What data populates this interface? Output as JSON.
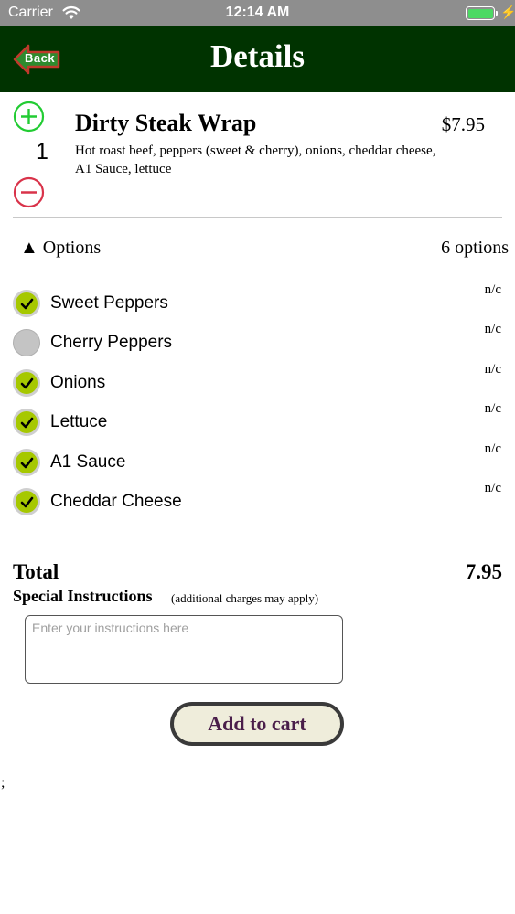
{
  "status_bar": {
    "carrier": "Carrier",
    "time": "12:14 AM",
    "battery_color": "#4cd964"
  },
  "nav": {
    "back_label": "Back",
    "title": "Details",
    "background_color": "#003300"
  },
  "item": {
    "quantity": "1",
    "name": "Dirty Steak Wrap",
    "price": "$7.95",
    "description": "Hot roast beef, peppers (sweet & cherry), onions, cheddar cheese, A1 Sauce, lettuce"
  },
  "options": {
    "toggle_label": "▲ Options",
    "count_label": "6 options",
    "items": [
      {
        "label": "Sweet Peppers",
        "price": "n/c",
        "checked": true
      },
      {
        "label": "Cherry Peppers",
        "price": "n/c",
        "checked": false
      },
      {
        "label": "Onions",
        "price": "n/c",
        "checked": true
      },
      {
        "label": "Lettuce",
        "price": "n/c",
        "checked": true
      },
      {
        "label": "A1 Sauce",
        "price": "n/c",
        "checked": true
      },
      {
        "label": "Cheddar Cheese",
        "price": "n/c",
        "checked": true
      }
    ]
  },
  "total": {
    "label": "Total",
    "value": "7.95"
  },
  "special_instructions": {
    "title": "Special Instructions",
    "note": "(additional charges may apply)",
    "placeholder": "Enter your instructions here",
    "value": ""
  },
  "actions": {
    "add_to_cart_label": "Add to cart"
  },
  "stray_text": ";",
  "colors": {
    "check_on": "#a6c800",
    "check_off": "#c4c4c4",
    "plus": "#22cc33",
    "minus": "#d9334a",
    "button_text": "#4a1e4a"
  },
  "icons": {
    "back": "back-arrow-icon",
    "plus": "plus-circle-icon",
    "minus": "minus-circle-icon",
    "check": "checkmark-icon",
    "wifi": "wifi-icon",
    "battery": "battery-icon",
    "bolt": "charging-bolt-icon"
  }
}
